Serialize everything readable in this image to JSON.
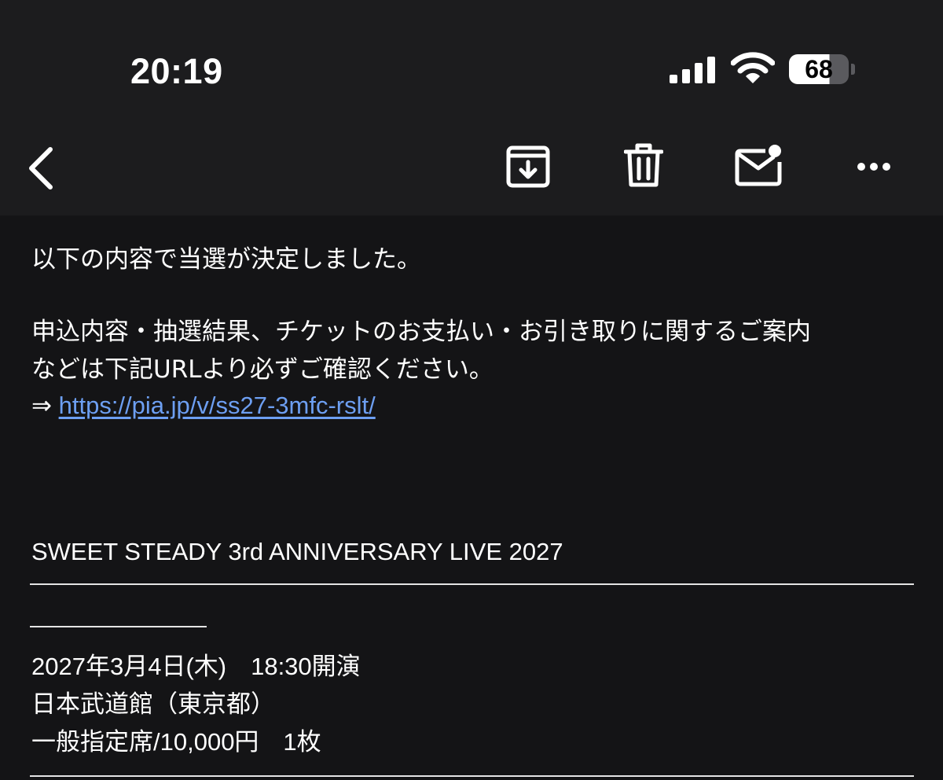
{
  "status_bar": {
    "time": "20:19",
    "battery_level": "68",
    "signal_icon": "cellular-signal-icon",
    "wifi_icon": "wifi-icon"
  },
  "toolbar": {
    "back_icon": "chevron-left-icon",
    "archive_icon": "archive-box-icon",
    "delete_icon": "trash-icon",
    "mark_unread_icon": "envelope-unread-icon",
    "more_icon": "ellipsis-icon"
  },
  "email": {
    "line1": "以下の内容で当選が決定しました。",
    "line2": "申込内容・抽選結果、チケットのお支払い・お引き取りに関するご案内",
    "line3": "などは下記URLより必ずご確認ください。",
    "arrow": "⇒",
    "url": "https://pia.jp/v/ss27-3mfc-rslt/",
    "event_title": "SWEET STEADY 3rd ANNIVERSARY LIVE 2027",
    "date_time": "2027年3月4日(木)　18:30開演",
    "venue": "日本武道館（東京都）",
    "seat": "一般指定席/10,000円　1枚"
  },
  "colors": {
    "header_bg": "#1c1c1e",
    "content_bg": "#141416",
    "link": "#6d9ff2",
    "text": "#ffffff"
  }
}
